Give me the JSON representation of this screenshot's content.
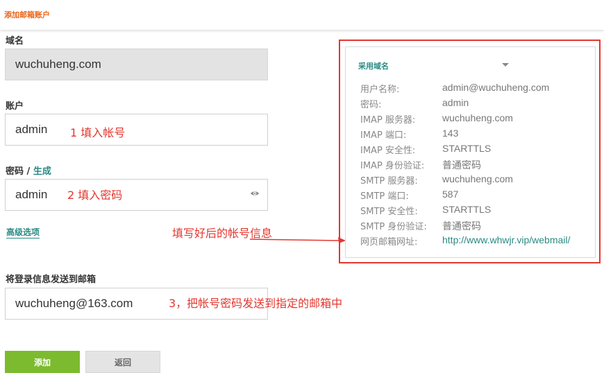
{
  "header": {
    "title": "添加邮箱账户"
  },
  "form": {
    "domain_label": "域名",
    "domain_value": "wuchuheng.com",
    "account_label": "账户",
    "account_value": "admin",
    "account_note": "1  填入帐号",
    "password_label": "密码 / ",
    "generate_label": "生成",
    "password_value": "admin",
    "password_note": "2  填入密码",
    "advanced_label": "高级选项",
    "send_label": "将登录信息发送到邮箱",
    "send_value": "wuchuheng@163.com",
    "send_note": "3，把帐号密码发送到指定的邮箱中",
    "add_button": "添加",
    "back_button": "返回"
  },
  "info_note": "填写好后的帐号信息",
  "panel": {
    "header": "采用域名",
    "rows": [
      {
        "k": "用户名称:",
        "v": "admin@wuchuheng.com"
      },
      {
        "k": "密码:",
        "v": "admin"
      },
      {
        "k": "IMAP 服务器:",
        "v": "wuchuheng.com"
      },
      {
        "k": "IMAP 端口:",
        "v": "143"
      },
      {
        "k": "IMAP 安全性:",
        "v": "STARTTLS"
      },
      {
        "k": "IMAP 身份验证:",
        "v": "普通密码"
      },
      {
        "k": "SMTP 服务器:",
        "v": "wuchuheng.com"
      },
      {
        "k": "SMTP 端口:",
        "v": "587"
      },
      {
        "k": "SMTP 安全性:",
        "v": "STARTTLS"
      },
      {
        "k": "SMTP 身份验证:",
        "v": "普通密码"
      },
      {
        "k": "网页邮箱网址:",
        "v": "http://www.whwjr.vip/webmail/"
      }
    ]
  },
  "colors": {
    "accent": "#2a8a84",
    "title": "#e8651b",
    "annotation": "#e2372f",
    "add_button": "#7cbb2f"
  }
}
